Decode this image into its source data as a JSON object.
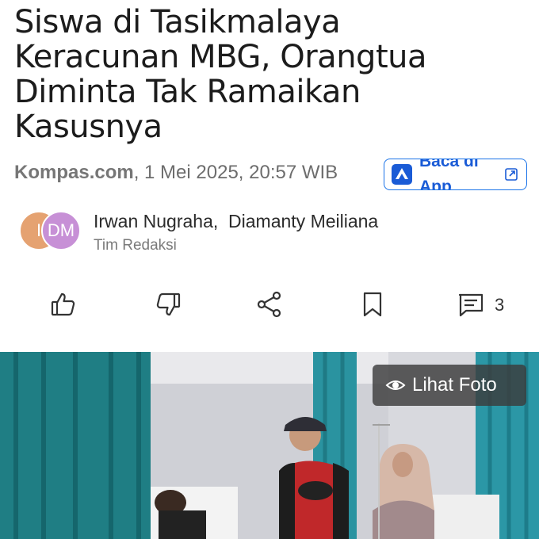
{
  "article": {
    "headline_lines": [
      "Siswa di Tasikmalaya",
      "Keracunan MBG, Orangtua",
      "Diminta Tak Ramaikan",
      "Kasusnya"
    ],
    "source": "Kompas.com",
    "date": ", 1 Mei 2025, 20:57 WIB"
  },
  "app_button": {
    "label_line1": "Baca di",
    "label_line2": "App",
    "accent": "#1a73e8"
  },
  "authors": {
    "avatars": [
      "I",
      "DM"
    ],
    "names": "Irwan Nugraha,  Diamanty Meiliana",
    "role": "Tim Redaksi"
  },
  "actions": {
    "icons": [
      "thumbs-up-icon",
      "thumbs-down-icon",
      "share-icon",
      "bookmark-icon",
      "comment-icon"
    ],
    "comment_count": "3"
  },
  "photo": {
    "view_label": "Lihat Foto"
  }
}
